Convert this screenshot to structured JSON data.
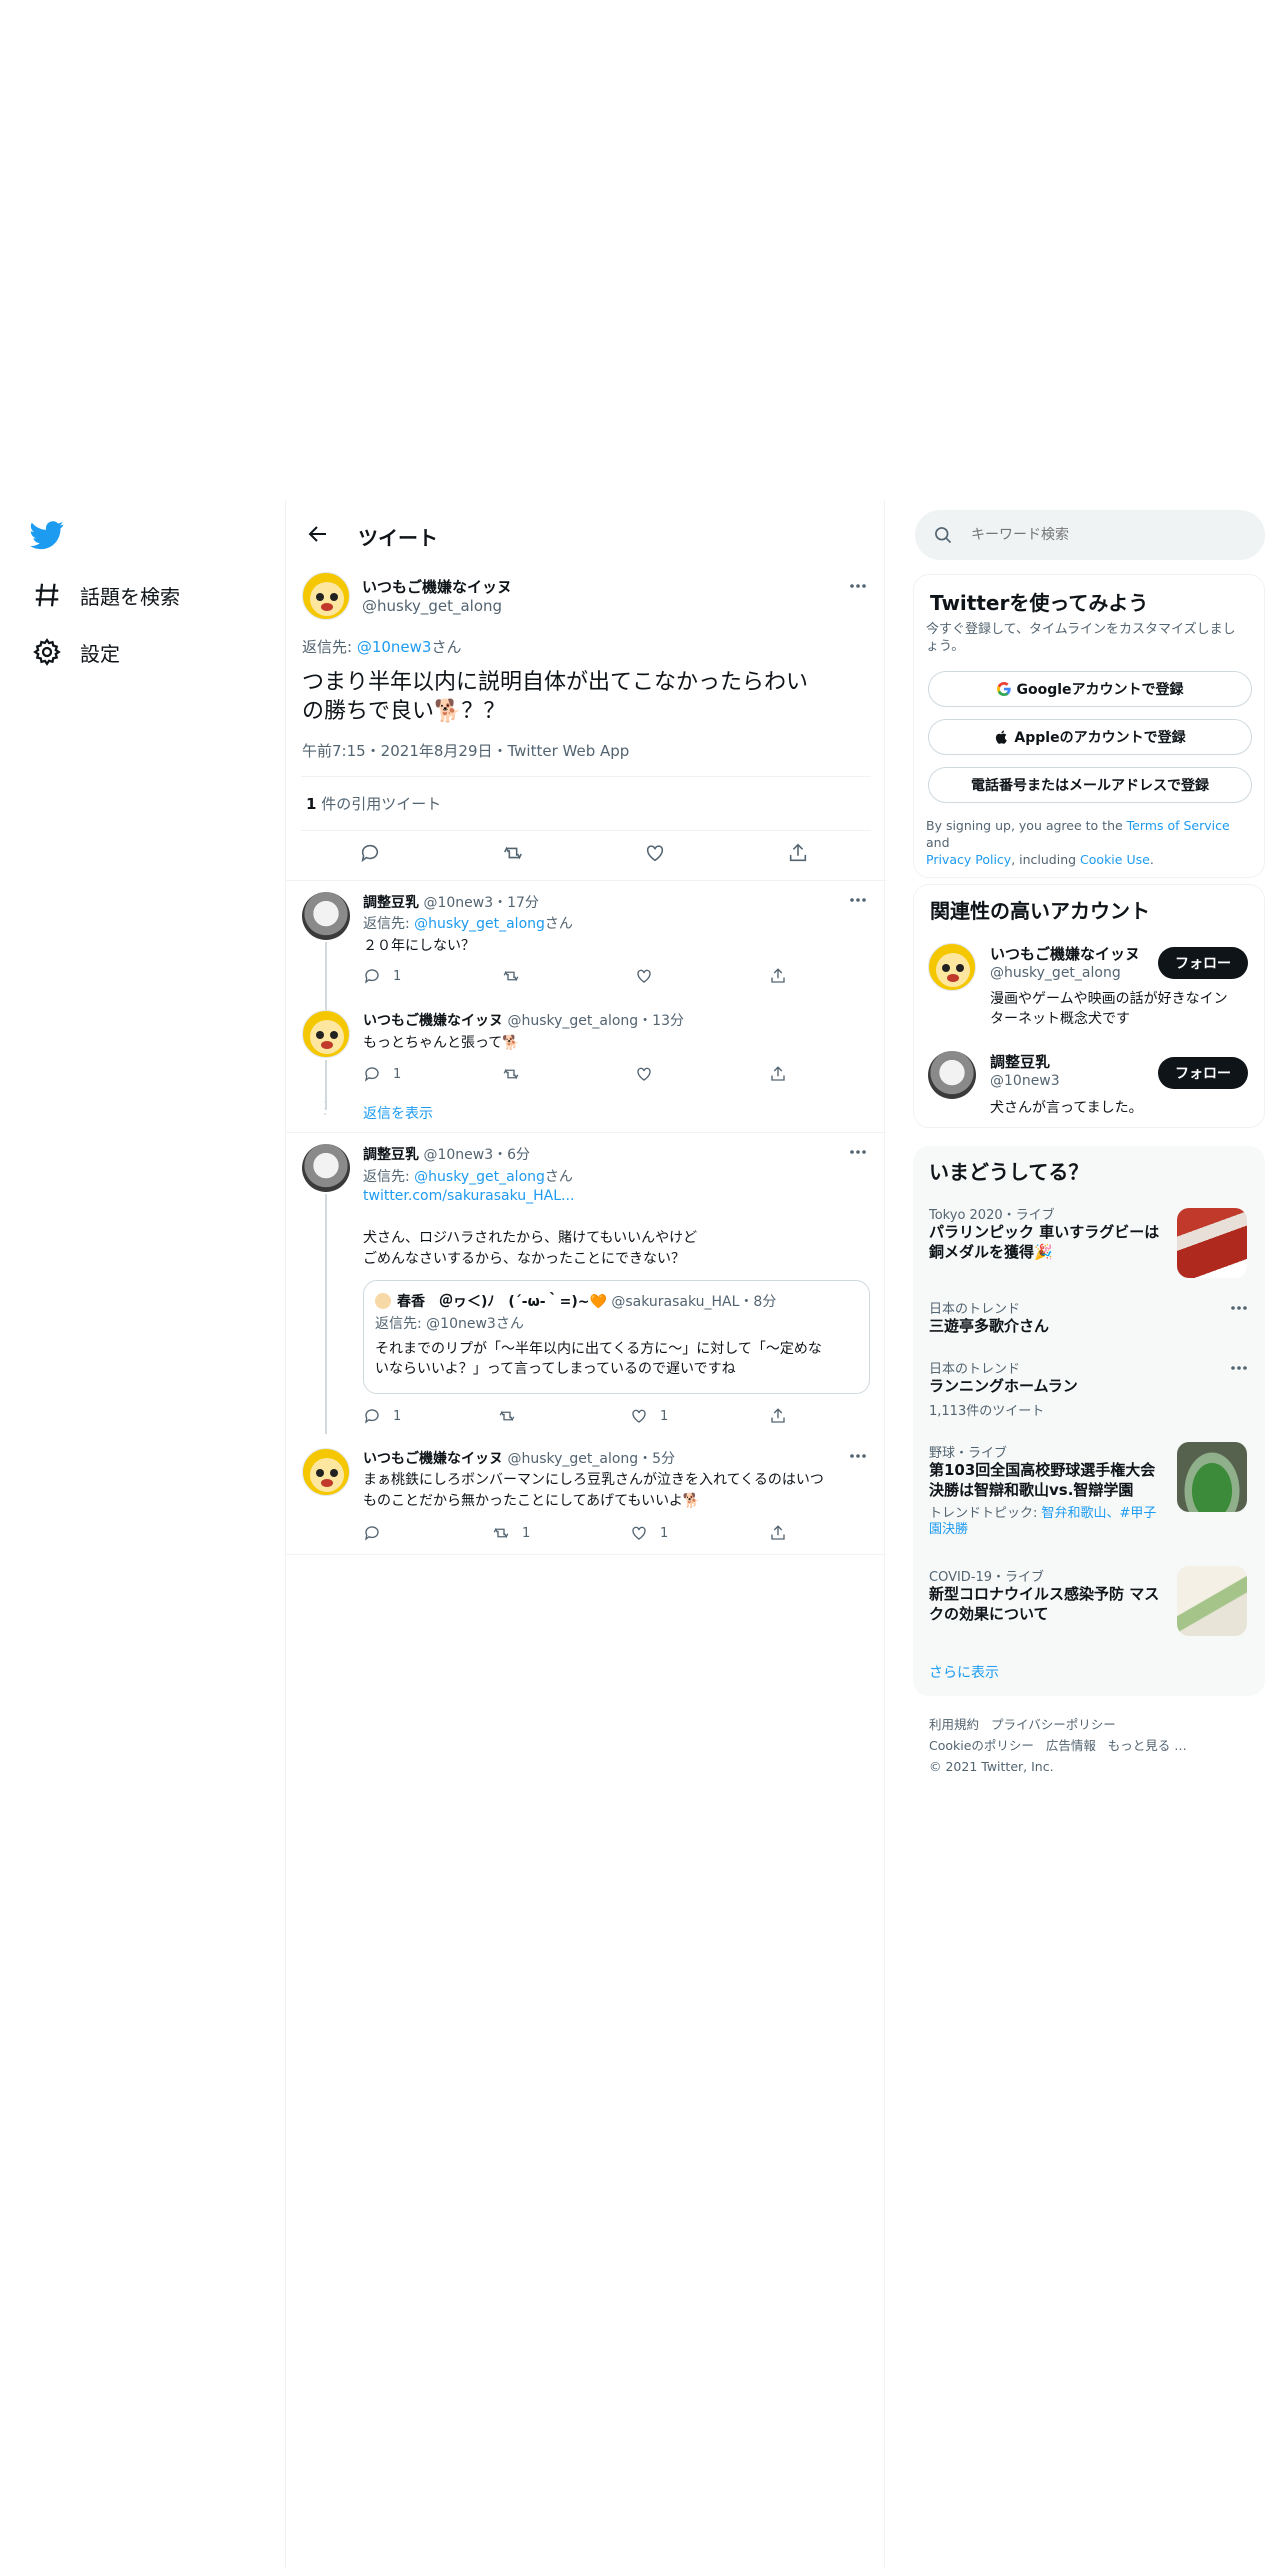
{
  "nav": {
    "explore_label": "話題を検索",
    "settings_label": "設定"
  },
  "header": {
    "title": "ツイート"
  },
  "main_tweet": {
    "author_name": "いつもご機嫌なイッヌ",
    "author_handle": "@husky_get_along",
    "reply_prefix": "返信先: ",
    "reply_to": "@10new3",
    "reply_suffix": "さん",
    "text_line1": "つまり半年以内に説明自体が出てこなかったらわい",
    "text_line2": "の勝ちで良い🐕？？",
    "timestamp": "午前7:15・2021年8月29日・Twitter Web App",
    "quote_count": "1",
    "quote_label": " 件の引用ツイート"
  },
  "replies": [
    {
      "name": "調整豆乳",
      "handle_time": "@10new3・17分",
      "reply_prefix": "返信先: ",
      "reply_to": "@husky_get_along",
      "reply_suffix": "さん",
      "text": "２０年にしない？",
      "reply_count": "1"
    },
    {
      "name": "いつもご機嫌なイッヌ",
      "handle_time": "@husky_get_along・13分",
      "text": "もっとちゃんと張って🐕",
      "reply_count": "1"
    },
    {
      "name": "調整豆乳",
      "handle_time": "@10new3・6分",
      "reply_prefix": "返信先: ",
      "reply_to": "@husky_get_along",
      "reply_suffix": "さん",
      "link": "twitter.com/sakurasaku_HAL...",
      "text_line1": "犬さん、ロジハラされたから、賭けてもいいんやけど",
      "text_line2": "ごめんなさいするから、なかったことにできない？",
      "reply_count": "1",
      "like_count": "1"
    },
    {
      "name": "いつもご機嫌なイッヌ",
      "handle_time": "@husky_get_along・5分",
      "text_line1": "まぁ桃鉄にしろボンバーマンにしろ豆乳さんが泣きを入れてくるのはいつ",
      "text_line2": "ものことだから無かったことにしてあげてもいいよ🐕",
      "retweet_count": "1",
      "like_count": "1"
    }
  ],
  "show_replies": "返信を表示",
  "quote": {
    "name": "春香　＠ヮ＜)ﾉ　(´-ω-｀=)~🧡",
    "handle_time": "@sakurasaku_HAL・8分",
    "reply_prefix": "返信先: ",
    "reply_to": "@10new3",
    "reply_suffix": "さん",
    "text_line1": "それまでのリプが「〜半年以内に出てくる方に〜」に対して「〜定めな",
    "text_line2": "いならいいよ？」って言ってしまっているので遅いですね"
  },
  "search": {
    "placeholder": "キーワード検索"
  },
  "signup": {
    "title": "Twitterを使ってみよう",
    "subtitle_line1": "今すぐ登録して、タイムラインをカスタマイズしまし",
    "subtitle_line2": "ょう。",
    "google_label": "Googleアカウントで登録",
    "apple_label": "Appleのアカウントで登録",
    "phone_label": "電話番号またはメールアドレスで登録",
    "terms_pre": "By signing up, you agree to the ",
    "terms_link": "Terms of Service",
    "terms_and": " and",
    "privacy_link": "Privacy Policy",
    "including": ", including ",
    "cookie_link": "Cookie Use",
    "period": "."
  },
  "related": {
    "title": "関連性の高いアカウント",
    "follow_label": "フォロー",
    "accounts": [
      {
        "name": "いつもご機嫌なイッヌ",
        "handle": "@husky_get_along",
        "bio_line1": "漫画やゲームや映画の話が好きなイン",
        "bio_line2": "ターネット概念犬です"
      },
      {
        "name": "調整豆乳",
        "handle": "@10new3",
        "bio_line1": "犬さんが言ってました。"
      }
    ]
  },
  "trends": {
    "title": "いまどうしてる？",
    "items": [
      {
        "meta": "Tokyo 2020・ライブ",
        "name_line1": "パラリンピック 車いすラグビーは",
        "name_line2": "銅メダルを獲得🎉"
      },
      {
        "meta": "日本のトレンド",
        "name_line1": "三遊亭多歌介さん"
      },
      {
        "meta": "日本のトレンド",
        "name_line1": "ランニングホームラン",
        "count": "1,113件のツイート"
      },
      {
        "meta": "野球・ライブ",
        "name_line1": "第103回全国高校野球選手権大会",
        "name_line2": "決勝は智辯和歌山vs.智辯学園",
        "topic_pre": "トレンドトピック: ",
        "topic_line1": "智弁和歌山、#甲子",
        "topic_line2": "園決勝"
      },
      {
        "meta": "COVID-19・ライブ",
        "name_line1": "新型コロナウイルス感染予防 マス",
        "name_line2": "クの効果について"
      }
    ],
    "show_more": "さらに表示"
  },
  "footer": {
    "terms": "利用規約",
    "privacy": "プライバシーポリシー",
    "cookie": "Cookieのポリシー",
    "ads": "広告情報",
    "more": "もっと見る …",
    "copyright": "© 2021 Twitter, Inc."
  },
  "colors": {
    "accent": "#1d9bf0",
    "text": "#0f1419",
    "secondary": "#536471"
  }
}
